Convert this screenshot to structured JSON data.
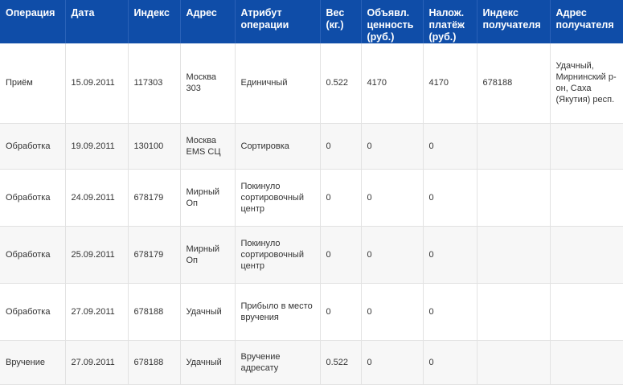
{
  "table": {
    "headers": [
      "Операция",
      "Дата",
      "Индекс",
      "Адрес",
      "Атрибут операции",
      "Вес (кг.)",
      "Объявл. ценность (руб.)",
      "Налож. платёж (руб.)",
      "Индекс получателя",
      "Адрес получателя"
    ],
    "rows": [
      [
        "Приём",
        "15.09.2011",
        "117303",
        "Москва 303",
        "Единичный",
        "0.522",
        "4170",
        "4170",
        "678188",
        "Удачный, Мирнинский р-он, Саха (Якутия) респ."
      ],
      [
        "Обработка",
        "19.09.2011",
        "130100",
        "Москва EMS СЦ",
        "Сортировка",
        "0",
        "0",
        "0",
        "",
        ""
      ],
      [
        "Обработка",
        "24.09.2011",
        "678179",
        "Мирный Оп",
        "Покинуло сортировочный центр",
        "0",
        "0",
        "0",
        "",
        ""
      ],
      [
        "Обработка",
        "25.09.2011",
        "678179",
        "Мирный Оп",
        "Покинуло сортировочный центр",
        "0",
        "0",
        "0",
        "",
        ""
      ],
      [
        "Обработка",
        "27.09.2011",
        "678188",
        "Удачный",
        "Прибыло в место вручения",
        "0",
        "0",
        "0",
        "",
        ""
      ],
      [
        "Вручение",
        "27.09.2011",
        "678188",
        "Удачный",
        "Вручение адресату",
        "0.522",
        "0",
        "0",
        "",
        ""
      ]
    ]
  },
  "colors": {
    "header_bg": "#0f4da8",
    "header_text": "#ffffff",
    "row_alt_bg": "#f7f7f7",
    "grid_line": "#e2e2e2",
    "body_text": "#333333"
  }
}
